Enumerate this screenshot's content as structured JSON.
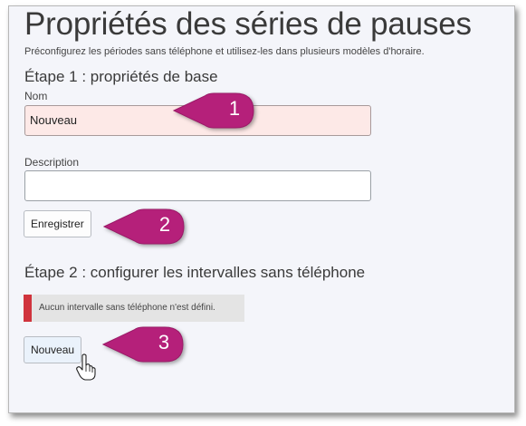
{
  "page": {
    "title": "Propriétés des séries de pauses",
    "subtitle": "Préconfigurez les périodes sans téléphone et utilisez-les dans plusieurs modèles d'horaire."
  },
  "step1": {
    "heading": "Étape 1 : propriétés de base",
    "name_label": "Nom",
    "name_value": "Nouveau",
    "description_label": "Description",
    "description_value": "",
    "save_label": "Enregistrer"
  },
  "step2": {
    "heading": "Étape 2 : configurer les intervalles sans téléphone",
    "alert_text": "Aucun intervalle sans téléphone n'est défini.",
    "new_label": "Nouveau"
  },
  "callouts": {
    "one": "1",
    "two": "2",
    "three": "3",
    "color": "#b5207a"
  },
  "colors": {
    "alert_accent": "#d0343d",
    "name_field_bg": "#fde9e7"
  },
  "icons": {
    "cursor": "hand-pointer-icon"
  }
}
